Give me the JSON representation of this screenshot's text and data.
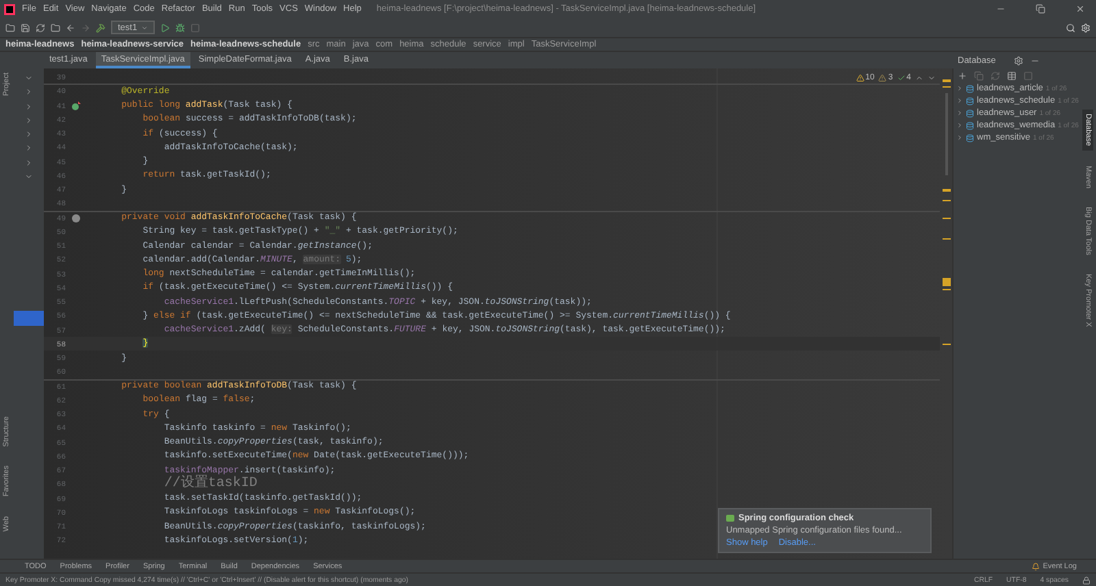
{
  "window": {
    "title": "heima-leadnews [F:\\project\\heima-leadnews] - TaskServiceImpl.java [heima-leadnews-schedule]"
  },
  "menu": [
    "File",
    "Edit",
    "View",
    "Navigate",
    "Code",
    "Refactor",
    "Build",
    "Run",
    "Tools",
    "VCS",
    "Window",
    "Help"
  ],
  "toolbar": {
    "run_config": "test1"
  },
  "breadcrumbs": [
    "heima-leadnews",
    "heima-leadnews-service",
    "heima-leadnews-schedule",
    "src",
    "main",
    "java",
    "com",
    "heima",
    "schedule",
    "service",
    "impl",
    "TaskServiceImpl"
  ],
  "tabs": [
    {
      "label": "test1.java",
      "selected": false
    },
    {
      "label": "TaskServiceImpl.java",
      "selected": true
    },
    {
      "label": "SimpleDateFormat.java",
      "selected": false
    },
    {
      "label": "A.java",
      "selected": false
    },
    {
      "label": "B.java",
      "selected": false
    }
  ],
  "left_strip": [
    "Project",
    "Structure",
    "Favorites",
    "Web"
  ],
  "project_tree": {
    "rows": [
      {
        "expanded": true
      },
      {
        "expanded": false
      },
      {
        "expanded": false
      },
      {
        "expanded": false
      },
      {
        "expanded": false
      },
      {
        "expanded": false
      },
      {
        "expanded": false
      },
      {
        "expanded": true
      }
    ],
    "selected_row": {
      "selected": true
    }
  },
  "inspections": {
    "warnings": "10",
    "weak_warnings": "3",
    "typos": "4"
  },
  "editor": {
    "lines": [
      {
        "number": "39",
        "separator": false,
        "current": false
      },
      {
        "number": "40",
        "separator": true,
        "current": false,
        "tokens": [
          {
            "kind": "annotation",
            "text": "    @Override"
          }
        ]
      },
      {
        "number": "41",
        "separator": false,
        "current": false,
        "kind": "implements",
        "tokens": [
          {
            "kind": "keyword",
            "text": "    public long "
          },
          {
            "kind": "decl",
            "text": "addTask"
          },
          {
            "kind": "plain",
            "text": "(Task task) {"
          }
        ]
      },
      {
        "number": "42",
        "separator": false,
        "current": false,
        "tokens": [
          {
            "kind": "keyword",
            "text": "        boolean "
          },
          {
            "kind": "plain",
            "text": "success = addTaskInfoToDB(task);"
          }
        ]
      },
      {
        "number": "43",
        "separator": false,
        "current": false,
        "tokens": [
          {
            "kind": "keyword",
            "text": "        if "
          },
          {
            "kind": "plain",
            "text": "(success) {"
          }
        ]
      },
      {
        "number": "44",
        "separator": false,
        "current": false,
        "tokens": [
          {
            "kind": "plain",
            "text": "            addTaskInfoToCache(task);"
          }
        ]
      },
      {
        "number": "45",
        "separator": false,
        "current": false,
        "tokens": [
          {
            "kind": "plain",
            "text": "        }"
          }
        ]
      },
      {
        "number": "46",
        "separator": false,
        "current": false,
        "tokens": [
          {
            "kind": "keyword",
            "text": "        return "
          },
          {
            "kind": "plain",
            "text": "task.getTaskId();"
          }
        ]
      },
      {
        "number": "47",
        "separator": false,
        "current": false,
        "tokens": [
          {
            "kind": "plain",
            "text": "    }"
          }
        ]
      },
      {
        "number": "48",
        "separator": false,
        "current": false
      },
      {
        "number": "49",
        "separator": true,
        "current": false,
        "kind": "usage",
        "tokens": [
          {
            "kind": "keyword",
            "text": "    private void "
          },
          {
            "kind": "decl",
            "text": "addTaskInfoToCache"
          },
          {
            "kind": "plain",
            "text": "(Task task) {"
          }
        ]
      },
      {
        "number": "50",
        "separator": false,
        "current": false,
        "tokens": [
          {
            "kind": "plain",
            "text": "        String key = task.getTaskType() + "
          },
          {
            "kind": "string",
            "text": "\"_\""
          },
          {
            "kind": "plain",
            "text": " + task.getPriority();"
          }
        ]
      },
      {
        "number": "51",
        "separator": false,
        "current": false,
        "tokens": [
          {
            "kind": "plain",
            "text": "        Calendar calendar = Calendar."
          },
          {
            "kind": "italic",
            "text": "getInstance"
          },
          {
            "kind": "plain",
            "text": "();"
          }
        ]
      },
      {
        "number": "52",
        "separator": false,
        "current": false,
        "tokens": [
          {
            "kind": "plain",
            "text": "        calendar.add(Calendar."
          },
          {
            "kind": "static",
            "text": "MINUTE"
          },
          {
            "kind": "plain",
            "text": ", "
          },
          {
            "kind": "hint",
            "text": "amount:"
          },
          {
            "kind": "number",
            "text": " 5"
          },
          {
            "kind": "plain",
            "text": ");"
          }
        ]
      },
      {
        "number": "53",
        "separator": false,
        "current": false,
        "tokens": [
          {
            "kind": "keyword",
            "text": "        long "
          },
          {
            "kind": "plain",
            "text": "nextScheduleTime = calendar.getTimeInMillis();"
          }
        ]
      },
      {
        "number": "54",
        "separator": false,
        "current": false,
        "tokens": [
          {
            "kind": "keyword",
            "text": "        if "
          },
          {
            "kind": "plain",
            "text": "(task.getExecuteTime() <= System."
          },
          {
            "kind": "italic",
            "text": "currentTimeMillis"
          },
          {
            "kind": "plain",
            "text": "()) {"
          }
        ]
      },
      {
        "number": "55",
        "separator": false,
        "current": false,
        "tokens": [
          {
            "kind": "field",
            "text": "            cacheService1"
          },
          {
            "kind": "plain",
            "text": ".lLeftPush(ScheduleConstants."
          },
          {
            "kind": "static",
            "text": "TOPIC"
          },
          {
            "kind": "plain",
            "text": " + key, JSON."
          },
          {
            "kind": "italic",
            "text": "toJSONString"
          },
          {
            "kind": "plain",
            "text": "(task));"
          }
        ]
      },
      {
        "number": "56",
        "separator": false,
        "current": false,
        "tokens": [
          {
            "kind": "plain",
            "text": "        } "
          },
          {
            "kind": "keyword",
            "text": "else if "
          },
          {
            "kind": "plain",
            "text": "(task.getExecuteTime() <= nextScheduleTime && task.getExecuteTime() >= System."
          },
          {
            "kind": "italic",
            "text": "currentTimeMillis"
          },
          {
            "kind": "plain",
            "text": "()) {"
          }
        ]
      },
      {
        "number": "57",
        "separator": false,
        "current": false,
        "tokens": [
          {
            "kind": "field",
            "text": "            cacheService1"
          },
          {
            "kind": "plain",
            "text": ".zAdd( "
          },
          {
            "kind": "hint",
            "text": "key:"
          },
          {
            "kind": "plain",
            "text": " ScheduleConstants."
          },
          {
            "kind": "static",
            "text": "FUTURE"
          },
          {
            "kind": "plain",
            "text": " + key, JSON."
          },
          {
            "kind": "italic",
            "text": "toJSONString"
          },
          {
            "kind": "plain",
            "text": "(task), task.getExecuteTime());"
          }
        ]
      },
      {
        "number": "58",
        "separator": false,
        "current": true,
        "tokens": [
          {
            "kind": "brace",
            "text": "        }"
          }
        ]
      },
      {
        "number": "59",
        "separator": false,
        "current": false,
        "tokens": [
          {
            "kind": "plain",
            "text": "    }"
          }
        ]
      },
      {
        "number": "60",
        "separator": false,
        "current": false
      },
      {
        "number": "61",
        "separator": true,
        "current": false,
        "tokens": [
          {
            "kind": "keyword",
            "text": "    private boolean "
          },
          {
            "kind": "decl",
            "text": "addTaskInfoToDB"
          },
          {
            "kind": "plain",
            "text": "(Task task) {"
          }
        ]
      },
      {
        "number": "62",
        "separator": false,
        "current": false,
        "tokens": [
          {
            "kind": "keyword",
            "text": "        boolean "
          },
          {
            "kind": "plain",
            "text": "flag = "
          },
          {
            "kind": "keyword",
            "text": "false"
          },
          {
            "kind": "plain",
            "text": ";"
          }
        ]
      },
      {
        "number": "63",
        "separator": false,
        "current": false,
        "tokens": [
          {
            "kind": "keyword",
            "text": "        try "
          },
          {
            "kind": "plain",
            "text": "{"
          }
        ]
      },
      {
        "number": "64",
        "separator": false,
        "current": false,
        "tokens": [
          {
            "kind": "plain",
            "text": "            Taskinfo taskinfo = "
          },
          {
            "kind": "keyword",
            "text": "new "
          },
          {
            "kind": "plain",
            "text": "Taskinfo();"
          }
        ]
      },
      {
        "number": "65",
        "separator": false,
        "current": false,
        "tokens": [
          {
            "kind": "plain",
            "text": "            BeanUtils."
          },
          {
            "kind": "italic",
            "text": "copyProperties"
          },
          {
            "kind": "plain",
            "text": "(task, taskinfo);"
          }
        ]
      },
      {
        "number": "66",
        "separator": false,
        "current": false,
        "tokens": [
          {
            "kind": "plain",
            "text": "            taskinfo.setExecuteTime("
          },
          {
            "kind": "keyword",
            "text": "new "
          },
          {
            "kind": "plain",
            "text": "Date(task.getExecuteTime()));"
          }
        ]
      },
      {
        "number": "67",
        "separator": false,
        "current": false,
        "tokens": [
          {
            "kind": "field",
            "text": "            taskinfoMapper"
          },
          {
            "kind": "plain",
            "text": ".insert(taskinfo);"
          }
        ]
      },
      {
        "number": "68",
        "separator": false,
        "current": false,
        "tokens": [
          {
            "kind": "comment",
            "text": "            //设置taskID"
          }
        ]
      },
      {
        "number": "69",
        "separator": false,
        "current": false,
        "tokens": [
          {
            "kind": "plain",
            "text": "            task.setTaskId(taskinfo.getTaskId());"
          }
        ]
      },
      {
        "number": "70",
        "separator": false,
        "current": false,
        "tokens": [
          {
            "kind": "plain",
            "text": "            TaskinfoLogs taskinfoLogs = "
          },
          {
            "kind": "keyword",
            "text": "new "
          },
          {
            "kind": "plain",
            "text": "TaskinfoLogs();"
          }
        ]
      },
      {
        "number": "71",
        "separator": false,
        "current": false,
        "tokens": [
          {
            "kind": "plain",
            "text": "            BeanUtils."
          },
          {
            "kind": "italic",
            "text": "copyProperties"
          },
          {
            "kind": "plain",
            "text": "(taskinfo, taskinfoLogs);"
          }
        ]
      },
      {
        "number": "72",
        "separator": false,
        "current": false,
        "tokens": [
          {
            "kind": "plain",
            "text": "            taskinfoLogs.setVersion("
          },
          {
            "kind": "number",
            "text": "1"
          },
          {
            "kind": "plain",
            "text": ");"
          }
        ]
      }
    ]
  },
  "database": {
    "title": "Database",
    "items": [
      {
        "name": "leadnews_article",
        "hint": "1 of 26"
      },
      {
        "name": "leadnews_schedule",
        "hint": "1 of 26"
      },
      {
        "name": "leadnews_user",
        "hint": "1 of 26"
      },
      {
        "name": "leadnews_wemedia",
        "hint": "1 of 26"
      },
      {
        "name": "wm_sensitive",
        "hint": "1 of 26"
      }
    ]
  },
  "right_strip": [
    {
      "label": "Database",
      "selected": true
    },
    {
      "label": "Maven",
      "selected": false
    },
    {
      "label": "Big Data Tools",
      "selected": false
    },
    {
      "label": "Key Promoter X",
      "selected": false
    }
  ],
  "notification": {
    "title": "Spring configuration check",
    "message": "Unmapped Spring configuration files found...",
    "links": [
      "Show help",
      "Disable..."
    ]
  },
  "tool_windows": [
    "TODO",
    "Problems",
    "Profiler",
    "Spring",
    "Terminal",
    "Build",
    "Dependencies",
    "Services"
  ],
  "event_log": "Event Log",
  "status_bar": {
    "message": "Key Promoter X: Command Copy missed 4,274 time(s) // 'Ctrl+C' or 'Ctrl+Insert' // (Disable alert for this shortcut) (moments ago)",
    "items": [
      "CRLF",
      "UTF-8",
      "4 spaces"
    ]
  }
}
